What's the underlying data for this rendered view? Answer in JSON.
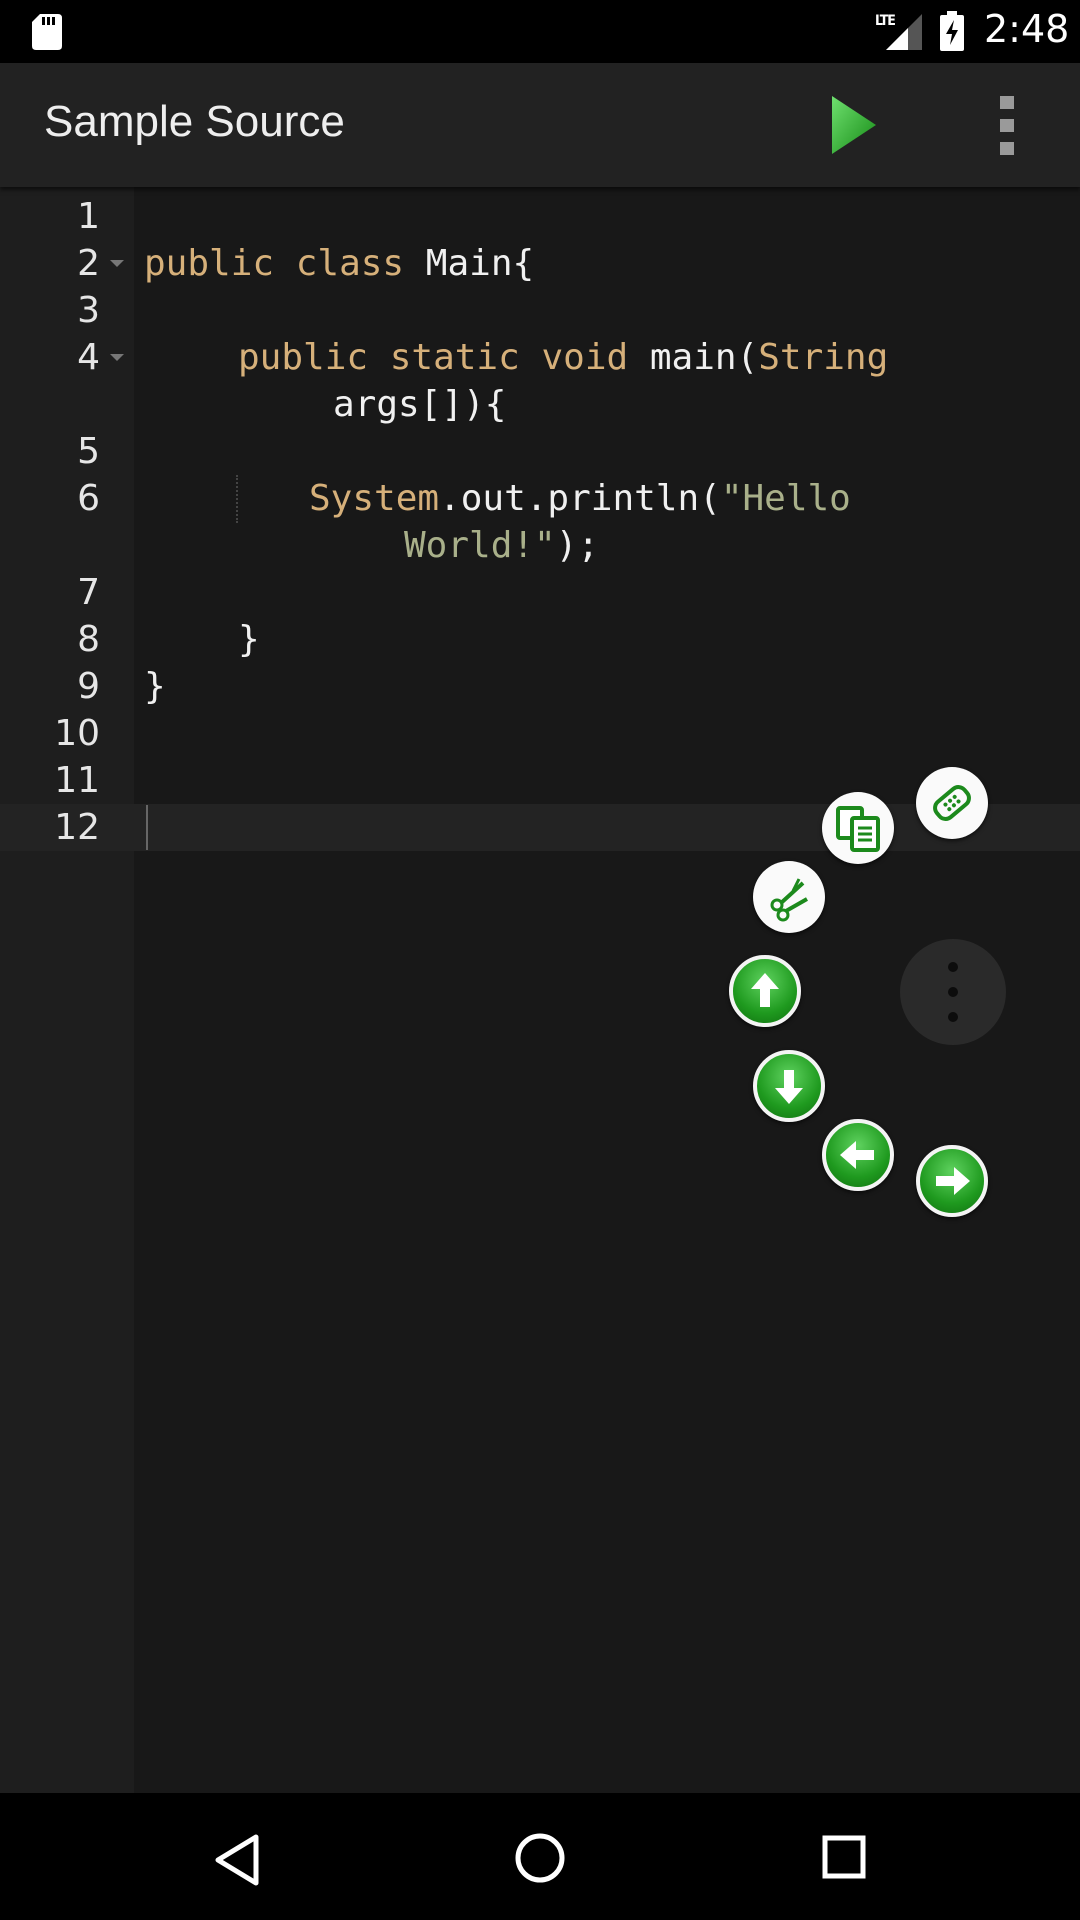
{
  "status_bar": {
    "time": "2:48",
    "network": "LTE",
    "icons": [
      "sd-card-icon",
      "signal-icon",
      "battery-charging-icon"
    ]
  },
  "app_bar": {
    "title": "Sample Source",
    "actions": [
      "run-icon",
      "overflow-menu-icon"
    ]
  },
  "editor": {
    "current_line": 12,
    "lines": [
      {
        "number": "1"
      },
      {
        "number": "2",
        "foldable": true
      },
      {
        "number": "3"
      },
      {
        "number": "4",
        "foldable": true
      },
      {
        "number": "5"
      },
      {
        "number": "6"
      },
      {
        "number": "7"
      },
      {
        "number": "8"
      },
      {
        "number": "9"
      },
      {
        "number": "10"
      },
      {
        "number": "11"
      },
      {
        "number": "12"
      }
    ],
    "code": {
      "l2_kw1": "public",
      "l2_kw2": "class",
      "l2_rest": "Main{",
      "l4_kw1": "public",
      "l4_kw2": "static",
      "l4_kw3": "void",
      "l4_rest": "main(",
      "l4_kw4": "String",
      "l4_wrap": "args[]){",
      "l6_sys": "System",
      "l6_rest": ".out.println(",
      "l6_str1": "\"Hello",
      "l6_str2": "World!\"",
      "l6_end": ");",
      "l8": "}",
      "l9": "}"
    }
  },
  "floating_tools": [
    {
      "name": "paste-icon",
      "style": "white"
    },
    {
      "name": "copy-icon",
      "style": "white"
    },
    {
      "name": "cut-icon",
      "style": "white"
    },
    {
      "name": "arrow-up-icon",
      "style": "green"
    },
    {
      "name": "arrow-down-icon",
      "style": "green"
    },
    {
      "name": "arrow-left-icon",
      "style": "green"
    },
    {
      "name": "arrow-right-icon",
      "style": "green"
    },
    {
      "name": "more-vertical-icon",
      "style": "dark"
    }
  ],
  "colors": {
    "keyword": "#d6b07a",
    "string": "#a9b08a",
    "text": "#f0f0f0",
    "run_green": "#2fb52f"
  },
  "nav_bar": [
    "back-icon",
    "home-icon",
    "recents-icon"
  ]
}
